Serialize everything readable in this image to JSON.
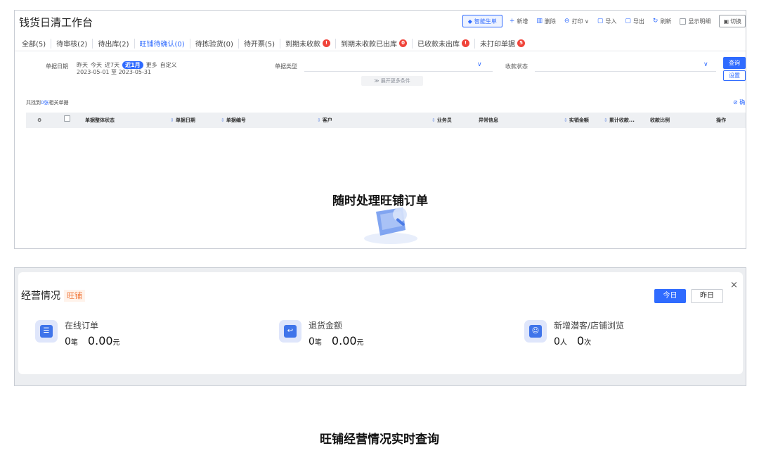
{
  "header": {
    "title": "钱货日清工作台",
    "smart_doc": "智能生单",
    "actions": [
      {
        "icon": "plus-icon",
        "glyph": "+",
        "label": "新增"
      },
      {
        "icon": "trash-icon",
        "glyph": "🗑",
        "label": "删除"
      },
      {
        "icon": "printer-icon",
        "glyph": "⎙",
        "label": "打印 ∨"
      },
      {
        "icon": "import-icon",
        "glyph": "⇩",
        "label": "导入"
      },
      {
        "icon": "export-icon",
        "glyph": "⇧",
        "label": "导出"
      },
      {
        "icon": "refresh-icon",
        "glyph": "↻",
        "label": "刷新"
      }
    ],
    "show_detail": "显示明细",
    "switch": "切换"
  },
  "tabs": [
    {
      "label": "全部(5)",
      "badge": ""
    },
    {
      "label": "待审核(2)",
      "badge": ""
    },
    {
      "label": "待出库(2)",
      "badge": ""
    },
    {
      "label": "旺铺待确认(0)",
      "badge": "",
      "active": true
    },
    {
      "label": "待拣验货(0)",
      "badge": ""
    },
    {
      "label": "待开票(5)",
      "badge": ""
    },
    {
      "label": "到期未收款",
      "badge": "!"
    },
    {
      "label": "到期未收款已出库",
      "badge": "0"
    },
    {
      "label": "已收款未出库",
      "badge": "!"
    },
    {
      "label": "未打印单据",
      "badge": "5"
    }
  ],
  "filters": {
    "date_label": "单据日期",
    "quick": [
      "昨天",
      "今天",
      "近7天",
      "近1月",
      "更多",
      "自定义"
    ],
    "quick_active": "近1月",
    "date_range": "2023-05-01 至 2023-05-31",
    "doc_type_label": "单据类型",
    "pay_status_label": "收款状态",
    "expand_more": "展开更多条件",
    "query_button": "查询",
    "settings_button": "设置"
  },
  "result": {
    "prefix": "共找到",
    "count": "0张",
    "suffix": "相关单据",
    "confirm_link": "⊘ 确"
  },
  "table": {
    "columns": [
      "单据整体状态",
      "单据日期",
      "单据编号",
      "客户",
      "业务员",
      "异常信息",
      "实销金额",
      "累计收款...",
      "收款比例",
      "操作"
    ]
  },
  "caption_top": "随时处理旺铺订单",
  "business": {
    "title": "经营情况",
    "tag": "旺铺",
    "today": "今日",
    "yesterday": "昨日",
    "close": "×",
    "metrics": [
      {
        "icon": "order-list-icon",
        "glyph": "☰",
        "label": "在线订单",
        "value_a": "0",
        "unit_a": "笔",
        "value_b": "0.00",
        "unit_b": "元"
      },
      {
        "icon": "refund-icon",
        "glyph": "↩",
        "label": "退货金额",
        "value_a": "0",
        "unit_a": "笔",
        "value_b": "0.00",
        "unit_b": "元"
      },
      {
        "icon": "visitor-icon",
        "glyph": "☺",
        "label": "新增潜客/店铺浏览",
        "value_a": "0",
        "unit_a": "人",
        "value_b": "0",
        "unit_b": "次"
      }
    ]
  },
  "caption_bottom": "旺铺经营情况实时查询",
  "colors": {
    "accent": "#2f6bff",
    "badge_red": "#f0443a",
    "tag_orange": "#f07b3f"
  }
}
